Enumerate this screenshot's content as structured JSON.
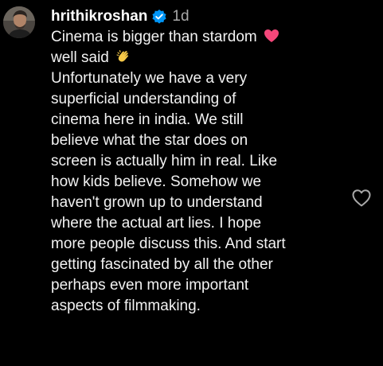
{
  "comment": {
    "username": "hrithikroshan",
    "timestamp": "1d",
    "verified_icon": "verified-badge-icon",
    "avatar_icon": "avatar",
    "lines": [
      "Cinema is bigger than stardom",
      "well said",
      "Unfortunately we have a very",
      "superficial understanding of",
      "cinema here in india. We still",
      "believe what the star does on",
      "screen is actually him in real. Like",
      "how kids believe. Somehow we",
      "haven't grown up to understand",
      "where the actual art lies. I hope",
      "more people discuss this. And start",
      "getting fascinated by all the other",
      "perhaps even more important",
      "aspects of filmmaking."
    ],
    "emojis": {
      "line_0": "heart-emoji-icon",
      "line_1": "clapping-hands-emoji-icon"
    },
    "like_icon": "heart-outline-icon"
  },
  "colors": {
    "background": "#000000",
    "text": "#f2f2f2",
    "muted": "#a8a8a8",
    "verified": "#0095f6",
    "heart_emoji": "#f4477a",
    "clap_emoji": "#f7c948"
  }
}
